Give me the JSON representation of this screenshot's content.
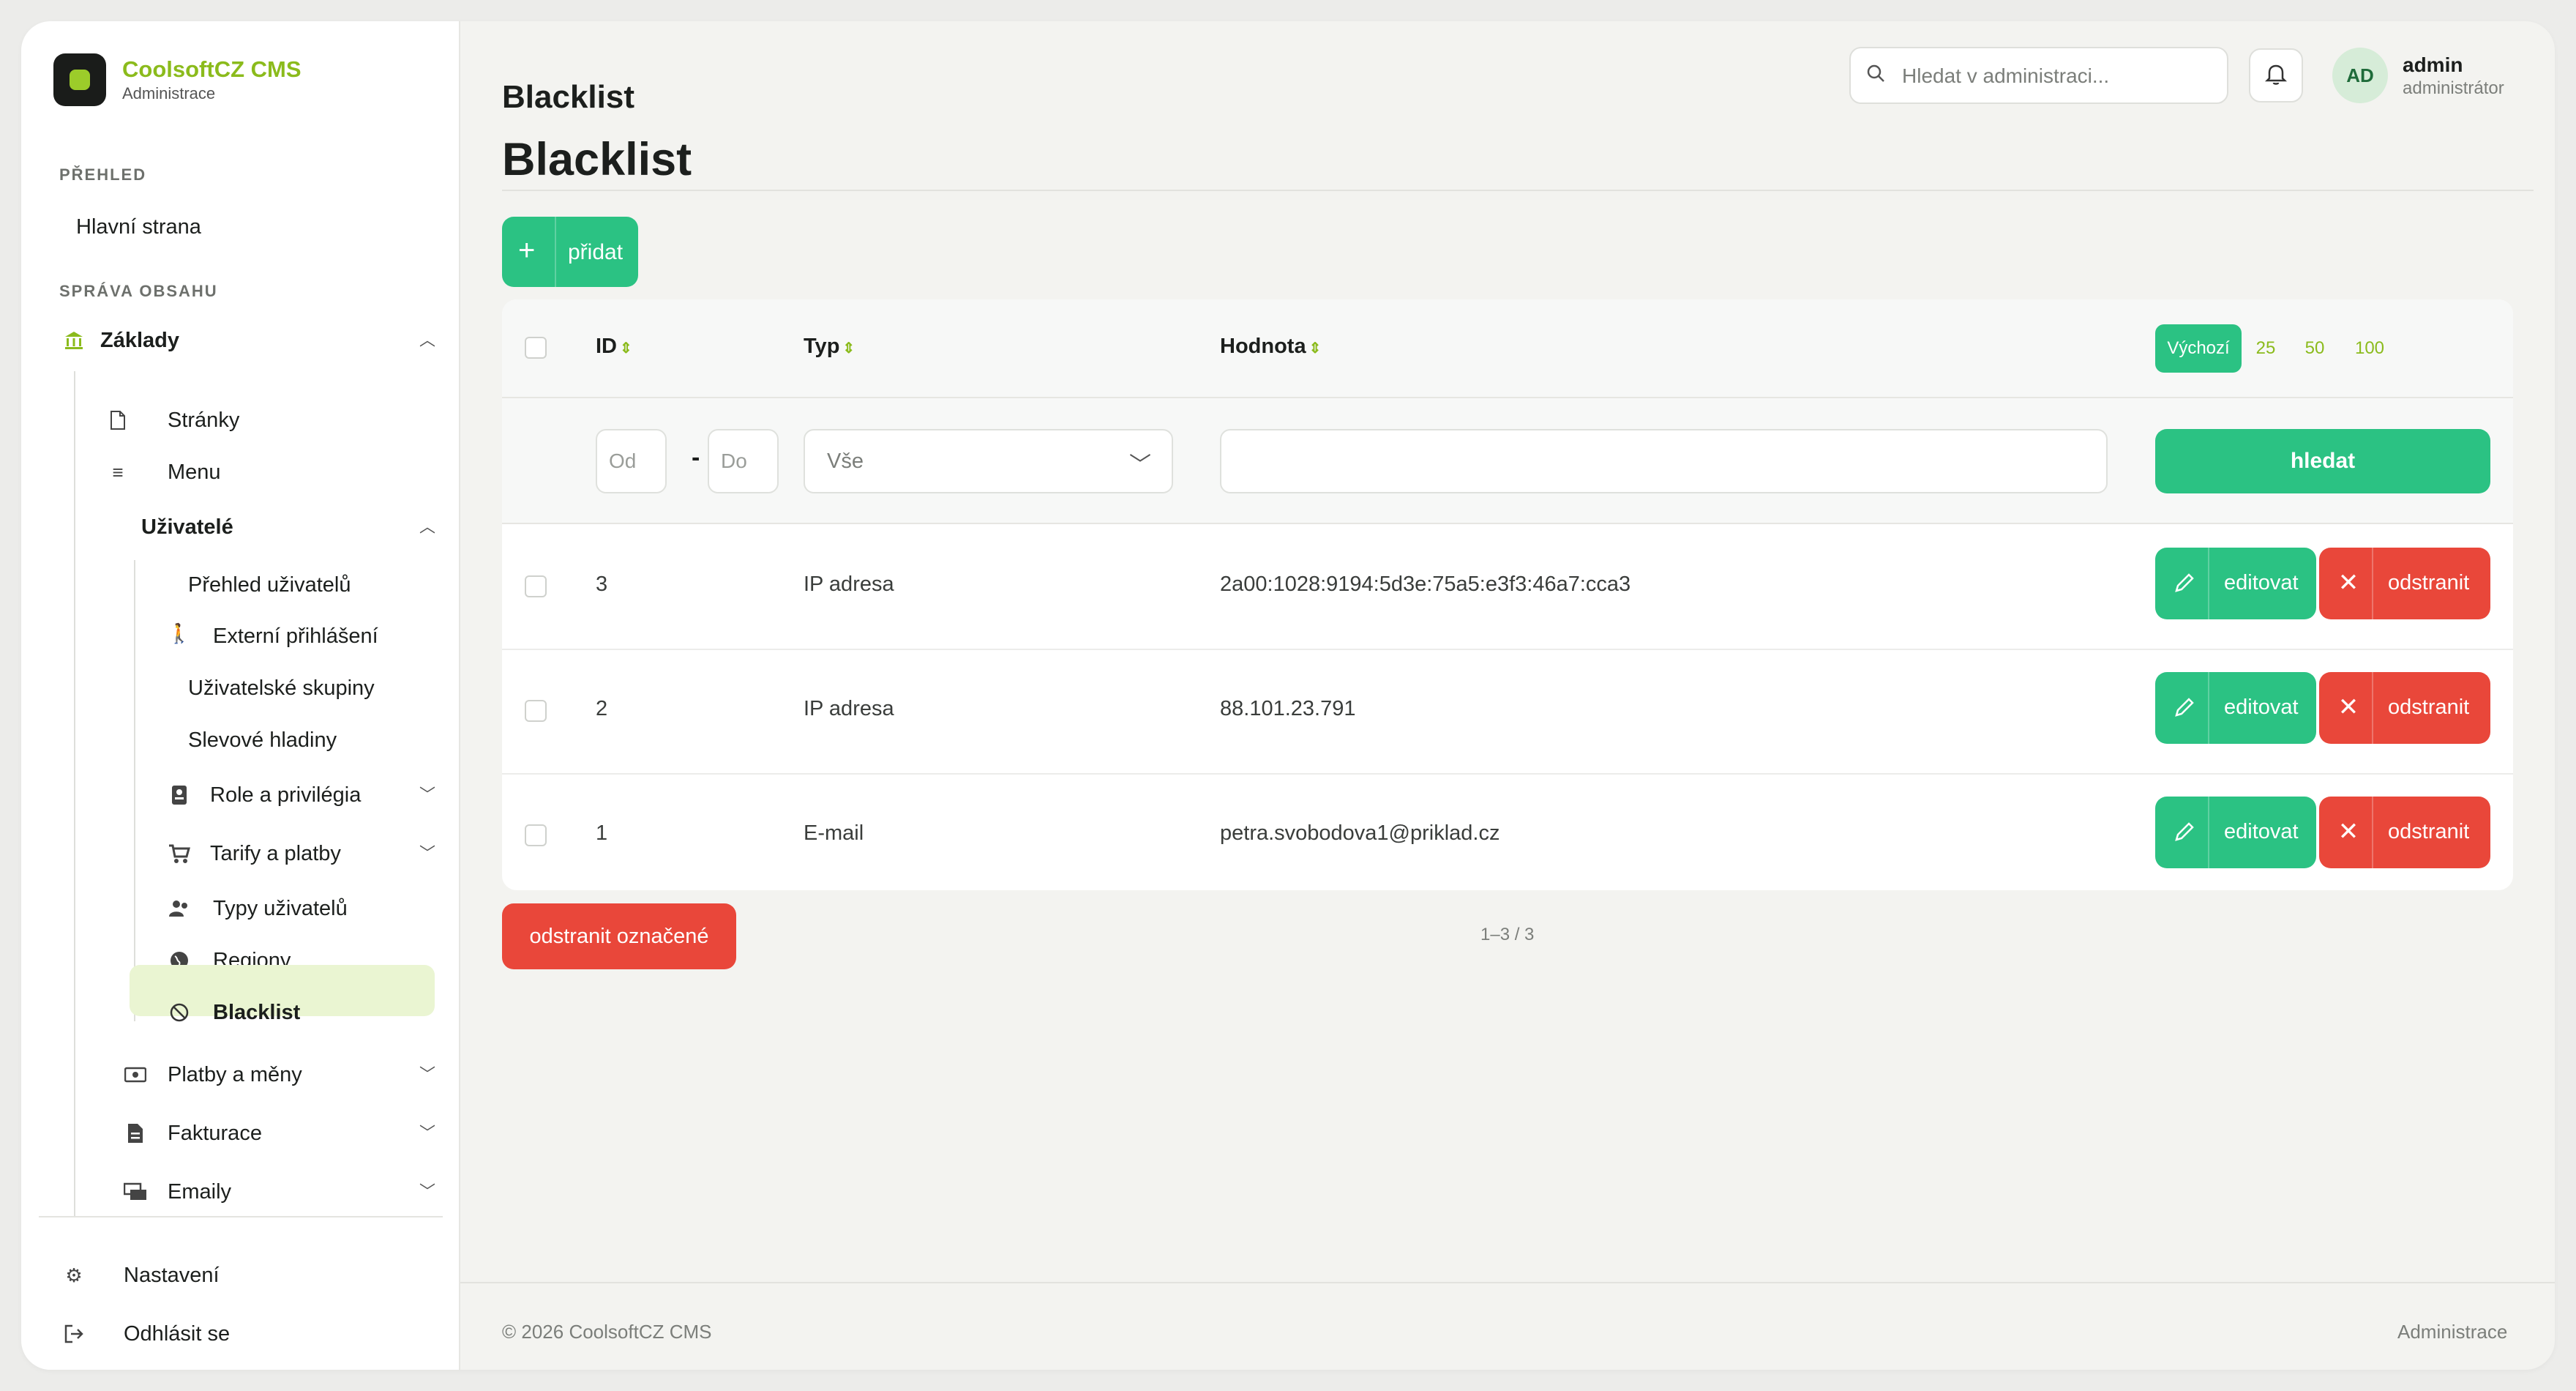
{
  "brand": {
    "name": "CoolsoftCZ CMS",
    "subtitle": "Administrace"
  },
  "sidebar": {
    "sections": [
      {
        "heading": "PŘEHLED"
      },
      {
        "heading": "SPRÁVA OBSAHU"
      }
    ],
    "items": {
      "home": "Hlavní strana",
      "zaklady": "Základy",
      "stranky": "Stránky",
      "menu": "Menu",
      "uzivatele": "Uživatelé",
      "prehled_uzivatelu": "Přehled uživatelů",
      "externi_prihlaseni": "Externí přihlášení",
      "uzivatelske_skupiny": "Uživatelské skupiny",
      "slevove_hladiny": "Slevové hladiny",
      "role": "Role a privilégia",
      "tarify": "Tarify a platby",
      "typy_uzivatelu": "Typy uživatelů",
      "regiony": "Regiony",
      "blacklist": "Blacklist",
      "platby": "Platby a měny",
      "fakturace": "Fakturace",
      "emaily": "Emaily",
      "nastaveni": "Nastavení",
      "odhlasit": "Odhlásit se"
    },
    "active_item": "blacklist"
  },
  "topbar": {
    "title": "Blacklist",
    "search_placeholder": "Hledat v administraci...",
    "avatar_initials": "AD",
    "user_name": "admin",
    "user_role": "administrátor"
  },
  "page": {
    "heading": "Blacklist",
    "add_label": "přidat"
  },
  "table": {
    "columns": {
      "id": "ID",
      "type": "Typ",
      "value": "Hodnota"
    },
    "per_page": {
      "default": "Výchozí",
      "options": [
        "25",
        "50",
        "100"
      ]
    },
    "filters": {
      "id_from_placeholder": "Od",
      "id_to_placeholder": "Do",
      "id_separator": "-",
      "type_selected": "Vše",
      "value_text": "",
      "search_label": "hledat"
    },
    "rows": [
      {
        "id": "3",
        "type": "IP adresa",
        "value": "2a00:1028:9194:5d3e:75a5:e3f3:46a7:cca3"
      },
      {
        "id": "2",
        "type": "IP adresa",
        "value": "88.101.23.791"
      },
      {
        "id": "1",
        "type": "E-mail",
        "value": "petra.svobodova1@priklad.cz"
      }
    ],
    "edit_label": "editovat",
    "delete_label": "odstranit"
  },
  "bulk_delete_label": "odstranit označené",
  "pagination": "1–3 / 3",
  "footer": {
    "left": "© 2026 CoolsoftCZ CMS",
    "right": "Administrace"
  },
  "colors": {
    "accent": "#2bc283",
    "danger": "#e9473a",
    "brand": "#8bbb1c",
    "active_bg": "#eaf5d2"
  }
}
